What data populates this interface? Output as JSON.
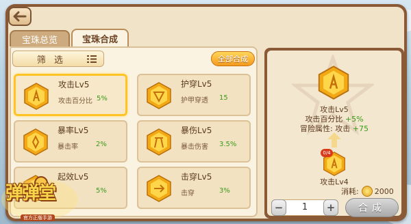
{
  "tabs": [
    {
      "label": "宝珠总览",
      "active": false
    },
    {
      "label": "宝珠合成",
      "active": true
    }
  ],
  "filter": {
    "label": "筛 选",
    "icon": "list-icon"
  },
  "merge_all": {
    "label": "全部合成"
  },
  "cards": [
    {
      "name": "攻击Lv5",
      "stat": "攻击百分比",
      "value": "5%",
      "selected": true,
      "icon": "attack-gem-icon"
    },
    {
      "name": "护穿Lv5",
      "stat": "护甲穿透",
      "value": "15",
      "selected": false,
      "icon": "armor-pierce-gem-icon"
    },
    {
      "name": "暴率Lv5",
      "stat": "暴击率",
      "value": "2%",
      "selected": false,
      "icon": "crit-rate-gem-icon"
    },
    {
      "name": "暴伤Lv5",
      "stat": "暴击伤害",
      "value": "3.5%",
      "selected": false,
      "icon": "crit-damage-gem-icon"
    },
    {
      "name": "起效Lv5",
      "stat": "",
      "value": "5%",
      "selected": false,
      "icon": "effect-gem-icon"
    },
    {
      "name": "击穿Lv5",
      "stat": "击穿",
      "value": "3%",
      "selected": false,
      "icon": "penetrate-gem-icon"
    }
  ],
  "detail": {
    "result_name": "攻击Lv5",
    "result_stat_label": "攻击百分比",
    "result_stat_value": "+5%",
    "adventure_label": "冒险属性: 攻击",
    "adventure_value": "+75",
    "source_name": "攻击Lv4",
    "source_badge": "0/4",
    "cost_label": "消耗:",
    "cost_value": "2000"
  },
  "stepper": {
    "minus": "−",
    "plus": "+",
    "value": "1"
  },
  "merge_button": {
    "label": "合成",
    "enabled": false
  },
  "logo": {
    "title": "弹弹堂",
    "subtitle": "官方正版手游"
  },
  "colors": {
    "panel": "#8a5a37",
    "accent_gold": "#ffc325",
    "green": "#3b9a1a",
    "gem": "#f5b21a"
  }
}
